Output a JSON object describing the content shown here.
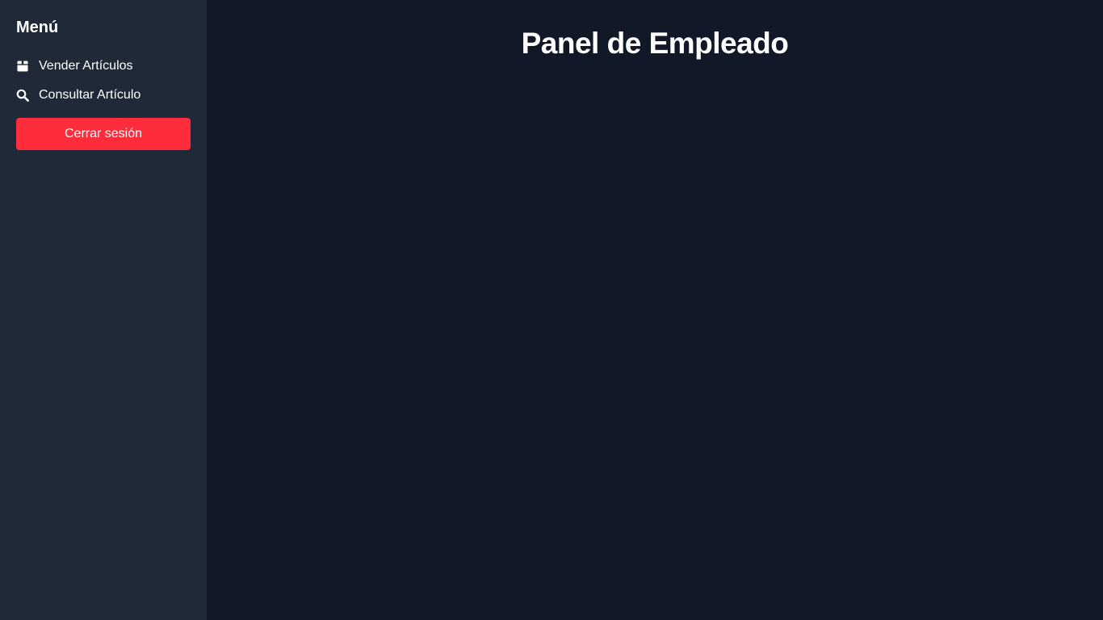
{
  "sidebar": {
    "title": "Menú",
    "items": [
      {
        "label": "Vender Artículos",
        "icon": "box-icon"
      },
      {
        "label": "Consultar Artículo",
        "icon": "search-icon"
      }
    ],
    "logout_label": "Cerrar sesión"
  },
  "main": {
    "title": "Panel de Empleado"
  },
  "colors": {
    "sidebar_bg": "#1f2937",
    "main_bg": "#111827",
    "logout_bg": "#ff2d3b",
    "text": "#ffffff"
  }
}
